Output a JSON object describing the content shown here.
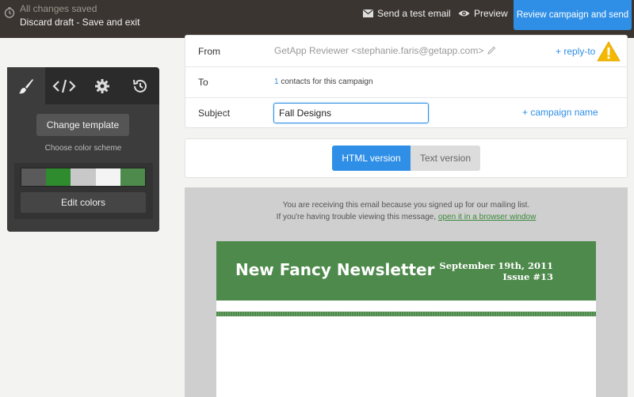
{
  "topbar": {
    "status": "All changes saved",
    "discard": "Discard draft - Save and exit",
    "send_test": "Send a test email",
    "preview": "Preview",
    "review": "Review campaign and send"
  },
  "tools": {
    "tabs": [
      "brush-icon",
      "code-icon",
      "gear-icon",
      "history-icon"
    ],
    "change_template": "Change template",
    "choose_scheme": "Choose color scheme",
    "swatches": [
      "#5a5a5a",
      "#2e8b2e",
      "#c8c8c8",
      "#f4f4f4",
      "#4e8a4b"
    ],
    "edit_colors": "Edit colors"
  },
  "form": {
    "from_label": "From",
    "from_value": "GetApp Reviewer <stephanie.faris@getapp.com>",
    "reply_to": "+ reply-to",
    "to_label": "To",
    "to_count": "1",
    "to_suffix": " contacts for this campaign",
    "subject_label": "Subject",
    "subject_value": "Fall Designs",
    "campaign_name": "+ campaign name"
  },
  "versions": {
    "html": "HTML version",
    "text": "Text version",
    "active": "html"
  },
  "email": {
    "notice1": "You are receiving this email because you signed up for our mailing list.",
    "notice2_prefix": "If you're having trouble viewing this message, ",
    "notice2_link": "open it in a browser window",
    "title": "New Fancy Newsletter",
    "date": "September 19th, 2011",
    "issue": "Issue #13"
  },
  "colors": {
    "topbar": "#3a3530",
    "accent": "#2f8fe6",
    "newsletter_green": "#4e8a4b",
    "warning": "#f5b800"
  }
}
